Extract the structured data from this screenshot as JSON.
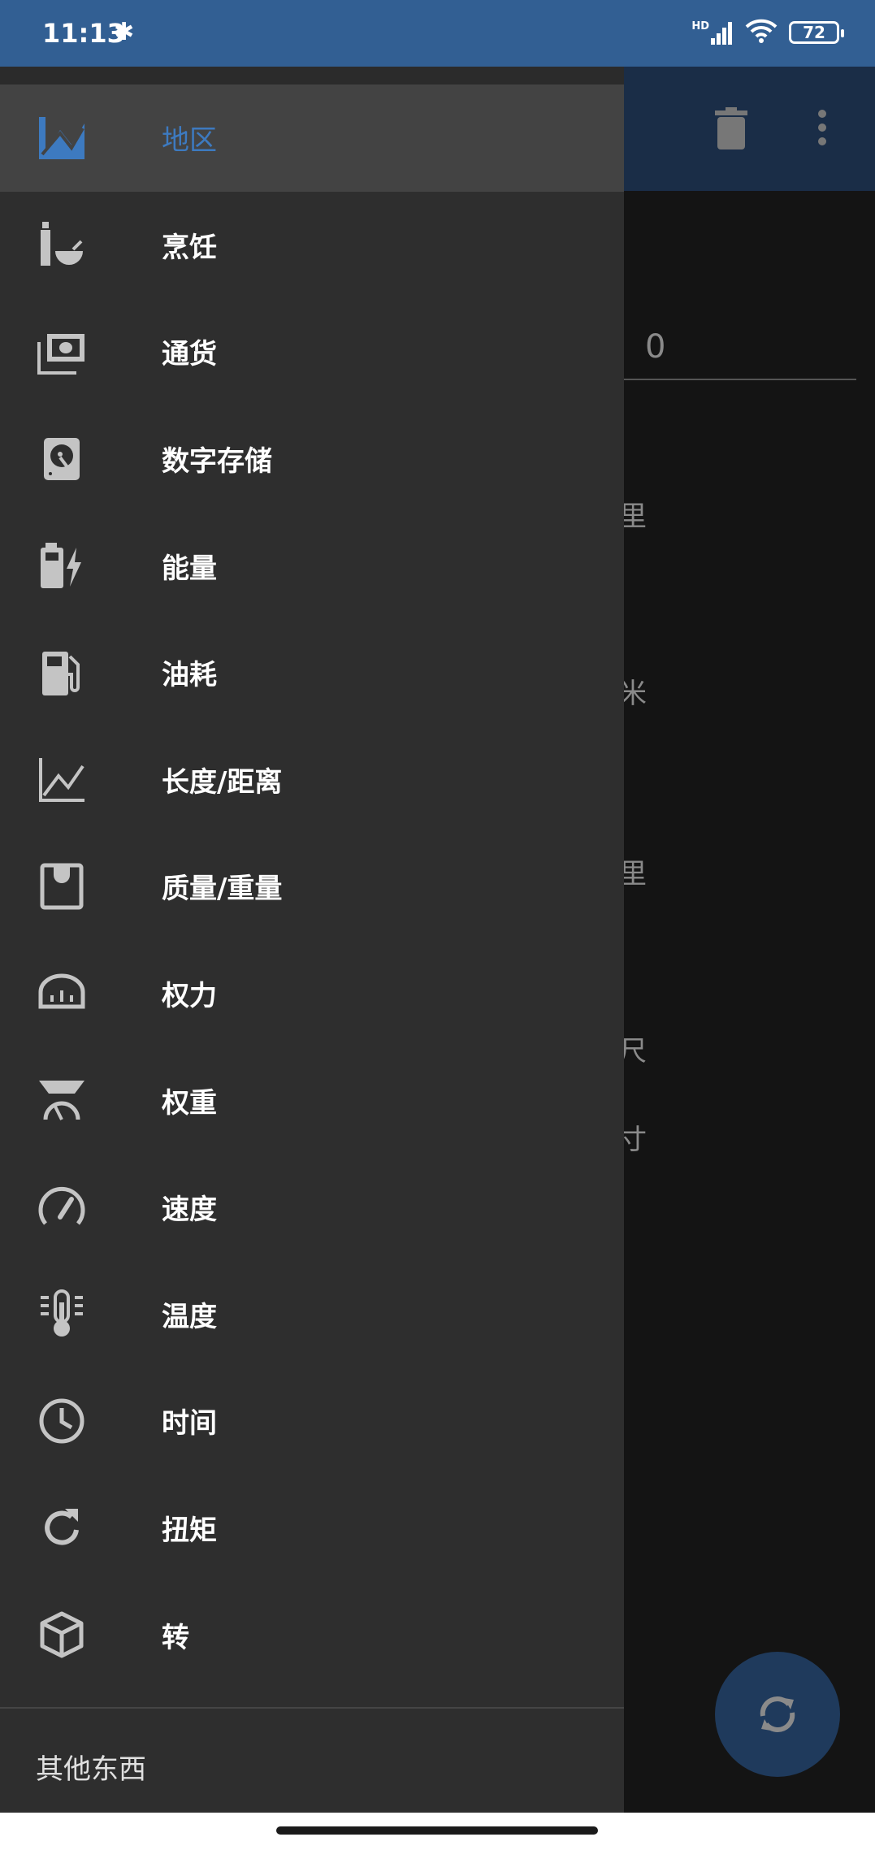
{
  "status_bar": {
    "time": "11:13",
    "bluetooth_icon": "bluetooth-icon",
    "network": "HD",
    "battery": "72"
  },
  "app_bar": {
    "delete_icon": "trash-icon",
    "more_icon": "more-vert-icon"
  },
  "main": {
    "input_value": "0",
    "unit_fragments": [
      "里",
      "米",
      "里",
      "尺",
      "寸"
    ]
  },
  "drawer": {
    "items": [
      {
        "label": "地区",
        "icon": "area-chart-icon",
        "selected": true
      },
      {
        "label": "烹饪",
        "icon": "cooking-icon"
      },
      {
        "label": "通货",
        "icon": "currency-icon"
      },
      {
        "label": "数字存储",
        "icon": "hard-drive-icon"
      },
      {
        "label": "能量",
        "icon": "battery-charging-icon"
      },
      {
        "label": "油耗",
        "icon": "fuel-icon"
      },
      {
        "label": "长度/距离",
        "icon": "line-chart-icon"
      },
      {
        "label": "质量/重量",
        "icon": "scale-icon"
      },
      {
        "label": "权力",
        "icon": "power-meter-icon"
      },
      {
        "label": "权重",
        "icon": "weight-scale-icon"
      },
      {
        "label": "速度",
        "icon": "speedometer-icon"
      },
      {
        "label": "温度",
        "icon": "thermometer-icon"
      },
      {
        "label": "时间",
        "icon": "clock-icon"
      },
      {
        "label": "扭矩",
        "icon": "rotate-icon"
      },
      {
        "label": "转",
        "icon": "cube-icon"
      }
    ],
    "other": "其他东西"
  },
  "colors": {
    "status_bar": "#325f93",
    "app_bar": "#1a2d47",
    "drawer": "#2e2e2e",
    "selected_bg": "#434343",
    "accent": "#3d7ac0",
    "icon": "#c4c4c4"
  }
}
